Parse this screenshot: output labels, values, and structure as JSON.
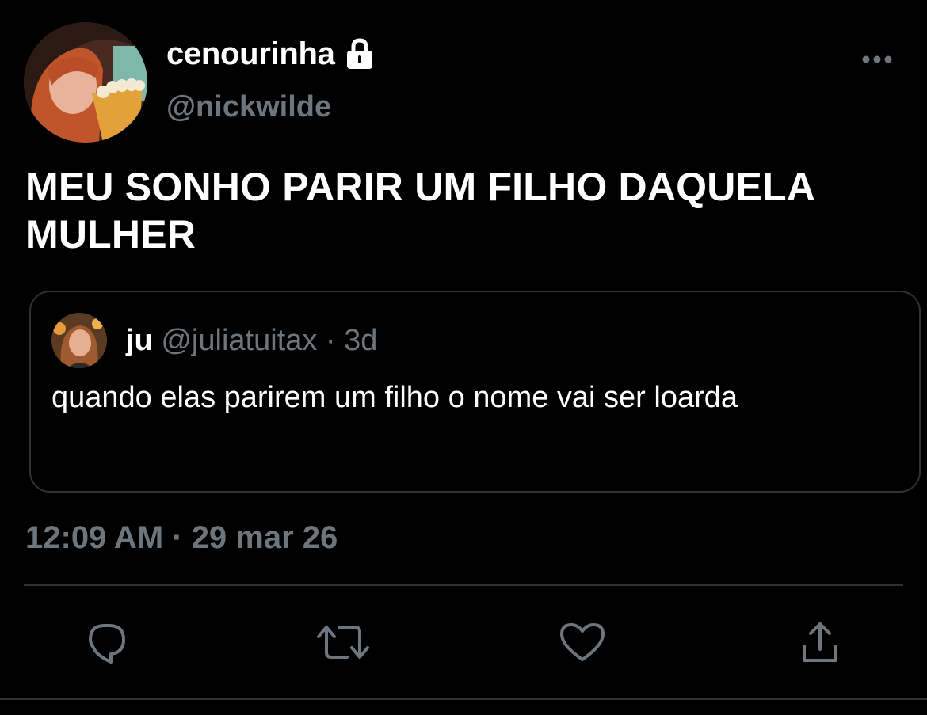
{
  "author": {
    "display_name": "cenourinha",
    "handle": "@nickwilde",
    "protected": true
  },
  "tweet": {
    "text": "MEU SONHO PARIR UM FILHO DAQUELA\nMULHER",
    "timestamp": "12:09 AM · 29 mar 26"
  },
  "quote": {
    "name": "ju",
    "handle": "@juliatuitax",
    "separator": "·",
    "time": "3d",
    "text": "quando elas parirem um filho o nome vai ser loarda"
  },
  "icons": {
    "lock": "lock-icon",
    "more": "more-icon",
    "reply": "reply-icon",
    "retweet": "retweet-icon",
    "like": "heart-icon",
    "share": "share-icon"
  },
  "colors": {
    "background": "#000000",
    "text": "#ffffff",
    "secondary": "#6e767d",
    "border": "#2f3336"
  }
}
